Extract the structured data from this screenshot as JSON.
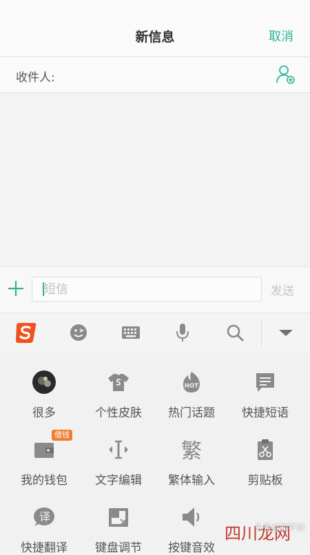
{
  "header": {
    "title": "新信息",
    "cancel_label": "取消"
  },
  "recipient": {
    "label": "收件人:"
  },
  "compose": {
    "placeholder": "短信",
    "send_label": "发送"
  },
  "toolbar": {
    "icons": [
      "sogou-logo-icon",
      "emoji-icon",
      "keyboard-icon",
      "microphone-icon",
      "search-icon",
      "collapse-arrow-icon"
    ]
  },
  "grid": {
    "items": [
      {
        "label": "很多",
        "icon": "avatar-icon"
      },
      {
        "label": "个性皮肤",
        "icon": "tshirt-skin-icon"
      },
      {
        "label": "热门话题",
        "icon": "hot-topic-icon"
      },
      {
        "label": "快捷短语",
        "icon": "quick-phrase-icon"
      },
      {
        "label": "我的钱包",
        "icon": "wallet-icon",
        "badge": "借钱"
      },
      {
        "label": "文字编辑",
        "icon": "text-edit-icon"
      },
      {
        "label": "繁体输入",
        "icon": "traditional-input-icon",
        "glyph": "繁"
      },
      {
        "label": "剪贴板",
        "icon": "clipboard-icon"
      },
      {
        "label": "快捷翻译",
        "icon": "translate-icon",
        "glyph": "译"
      },
      {
        "label": "键盘调节",
        "icon": "keyboard-adjust-icon"
      },
      {
        "label": "按键音效",
        "icon": "key-sound-icon"
      }
    ]
  },
  "watermark": {
    "logo_text": "四川龙网",
    "source_text": "头条@知不识"
  },
  "colors": {
    "accent": "#2bb59a",
    "sogou_orange": "#f0521e",
    "icon_gray": "#8a8a8a",
    "badge": "#ee7f31"
  }
}
